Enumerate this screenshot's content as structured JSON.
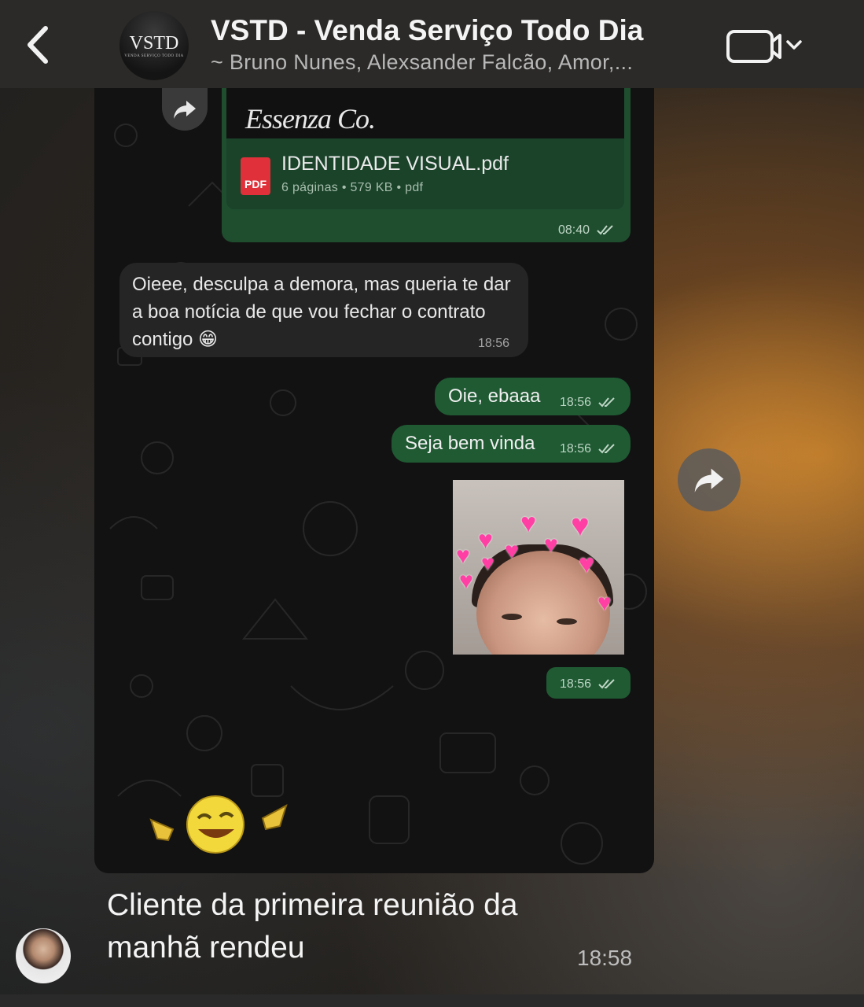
{
  "header": {
    "back_icon": "chevron-left-icon",
    "group_avatar_text": "VSTD",
    "group_avatar_sub": "VENDA SERVIÇO TODO DIA",
    "title": "VSTD - Venda Serviço Todo Dia",
    "members": "~ Bruno Nunes, Alexsander Falcão, Amor,...",
    "video_icon": "video-camera-icon"
  },
  "shared_message": {
    "pdf": {
      "preview_text": "Essenza Co.",
      "icon_label": "PDF",
      "filename": "IDENTIDADE VISUAL.pdf",
      "meta": "6 páginas • 579 KB • pdf",
      "time": "08:40"
    },
    "incoming": {
      "text": "Oieee, desculpa a demora, mas queria te dar a boa notícia de que vou fechar o contrato contigo 😁",
      "time": "18:56"
    },
    "outgoing": [
      {
        "text": "Oie, ebaaa",
        "time": "18:56"
      },
      {
        "text": "Seja bem vinda",
        "time": "18:56"
      }
    ],
    "sticker_time": "18:56",
    "emoji_sticker": "laughing-pointing-emoji"
  },
  "caption": {
    "text": "Cliente da primeira reunião da manhã rendeu",
    "time": "18:58"
  },
  "colors": {
    "header_bg": "#2b2a28",
    "outgoing_bubble": "#1f5a33",
    "incoming_bubble": "#252525",
    "chat_bg": "#121212"
  }
}
